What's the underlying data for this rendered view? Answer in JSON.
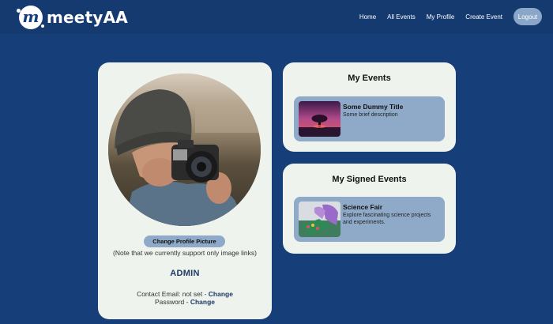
{
  "brand": {
    "name": "meetyAA",
    "mark": "m"
  },
  "nav": {
    "home": "Home",
    "all_events": "All Events",
    "my_profile": "My Profile",
    "create_event": "Create Event",
    "logout": "Logout"
  },
  "profile": {
    "change_picture_label": "Change Profile Picture",
    "note": "(Note that we currently support only image links)",
    "username": "ADMIN",
    "contact_prefix": "Contact Email: not set - ",
    "contact_change": "Change",
    "password_prefix": "Password - ",
    "password_change": "Change"
  },
  "my_events": {
    "title": "My Events",
    "items": [
      {
        "title": "Some Dummy Title",
        "description": "Some brief description"
      }
    ]
  },
  "signed_events": {
    "title": "My Signed Events",
    "items": [
      {
        "title": "Science Fair",
        "description": "Explore fascinating science projects and experiments."
      }
    ]
  },
  "colors": {
    "background": "#163e78",
    "navbar": "#143a70",
    "card": "#eef3ee",
    "event_item": "#8faac8",
    "logout_button": "#8aa6c8",
    "accent_text": "#1d3a66"
  }
}
